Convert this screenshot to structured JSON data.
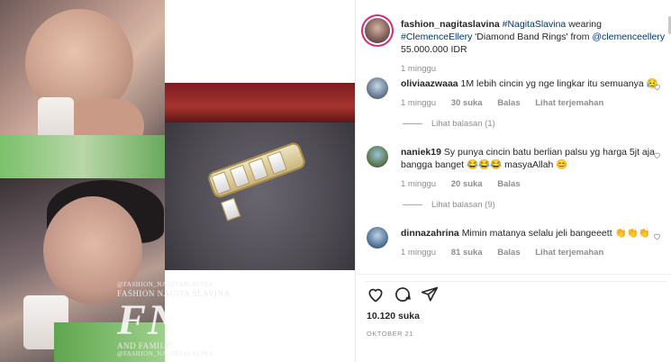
{
  "post": {
    "username": "fashion_nagitaslavina",
    "caption_parts": {
      "tag1": "#NagitaSlavina",
      "wearing": "wearing",
      "tag2": "#ClemenceEllery",
      "product": "'Diamond Band Rings' from",
      "mention": "@clemenceellery",
      "price": "55.000.000 IDR"
    },
    "time": "1 minggu"
  },
  "watermark": {
    "line1": "@FASHION_NAGITASLAVINA",
    "line2": "FASHION NAGITA SLAVINA",
    "logo": "FNS",
    "line3": "AND FAMILY",
    "line4": "@FASHION_NAGITASLAVINA"
  },
  "comments": [
    {
      "username": "oliviaazwaaa",
      "text": "1M lebih cincin yg nge lingkar itu semuanya 😥",
      "time": "1 minggu",
      "likes": "30 suka",
      "reply": "Balas",
      "translate": "Lihat terjemahan",
      "view_replies": "Lihat balasan (1)"
    },
    {
      "username": "naniek19",
      "text": "Sy punya cincin batu berlian palsu yg harga 5jt aja bangga banget 😂😂😂 masyaAllah 😊",
      "time": "1 minggu",
      "likes": "20 suka",
      "reply": "Balas",
      "view_replies": "Lihat balasan (9)"
    },
    {
      "username": "dinnazahrina",
      "text": "Mimin matanya selalu jeli bangeeett 👏👏👏",
      "time": "1 minggu",
      "likes": "81 suka",
      "reply": "Balas",
      "translate": "Lihat terjemahan"
    }
  ],
  "footer": {
    "likes": "10.120 suka",
    "date": "OKTOBER 21"
  },
  "icons": {
    "like": "heart-icon",
    "comment": "comment-icon",
    "share": "send-icon"
  },
  "colors": {
    "link": "#00376b",
    "muted": "#8e8e8e",
    "text": "#262626"
  }
}
